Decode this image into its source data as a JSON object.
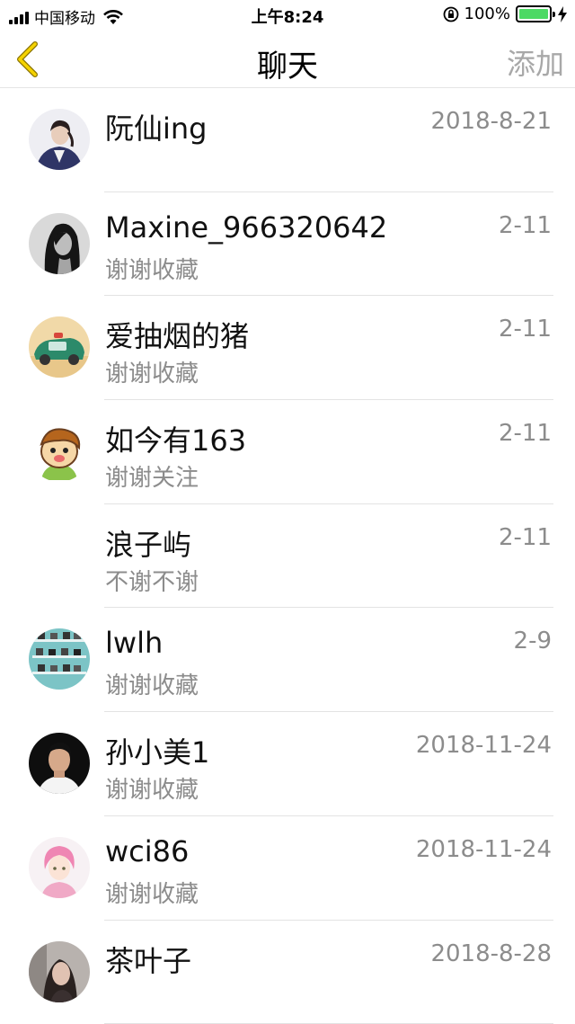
{
  "status_bar": {
    "carrier": "中国移动",
    "time": "上午8:24",
    "battery": "100%",
    "battery_color": "#4cd964"
  },
  "nav": {
    "back_icon": "chevron-left-icon",
    "back_color": "#e8c400",
    "title": "聊天",
    "add_label": "添加"
  },
  "chats": [
    {
      "name": "阮仙ing",
      "message": "",
      "date": "2018-8-21",
      "avatar": "avatar-woman-dark-coat"
    },
    {
      "name": "Maxine_966320642",
      "message": "谢谢收藏",
      "date": "2-11",
      "avatar": "avatar-woman-bw"
    },
    {
      "name": "爱抽烟的猪",
      "message": "谢谢收藏",
      "date": "2-11",
      "avatar": "avatar-toy-car"
    },
    {
      "name": "如今有163",
      "message": "谢谢关注",
      "date": "2-11",
      "avatar": "avatar-cartoon-monkey"
    },
    {
      "name": "浪子屿",
      "message": "不谢不谢",
      "date": "2-11",
      "avatar": ""
    },
    {
      "name": "lwlh",
      "message": "谢谢收藏",
      "date": "2-9",
      "avatar": "avatar-shelf-teal"
    },
    {
      "name": "孙小美1",
      "message": "谢谢收藏",
      "date": "2018-11-24",
      "avatar": "avatar-man-dark"
    },
    {
      "name": "wci86",
      "message": "谢谢收藏",
      "date": "2018-11-24",
      "avatar": "avatar-pink-hair-girl"
    },
    {
      "name": "茶叶子",
      "message": "",
      "date": "2018-8-28",
      "avatar": "avatar-woman-blurred"
    }
  ]
}
